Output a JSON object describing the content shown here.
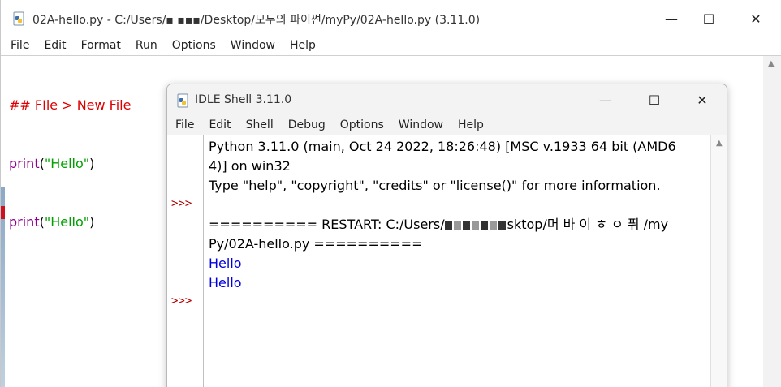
{
  "editor": {
    "title": "02A-hello.py - C:/Users/▪ ▪▪▪/Desktop/모두의 파이썬/myPy/02A-hello.py (3.11.0)",
    "menu": [
      "File",
      "Edit",
      "Format",
      "Run",
      "Options",
      "Window",
      "Help"
    ],
    "code": {
      "line1": "## FIle > New File",
      "line2_fn": "print",
      "line2_open": "(",
      "line2_str": "\"Hello\"",
      "line2_close": ")",
      "line3_fn": "print",
      "line3_open": "(",
      "line3_str": "\"Hello\"",
      "line3_close": ")"
    },
    "window_buttons": {
      "minimize": "—",
      "maximize": "☐",
      "close": "✕"
    }
  },
  "shell": {
    "title": "IDLE Shell 3.11.0",
    "menu": [
      "File",
      "Edit",
      "Shell",
      "Debug",
      "Options",
      "Window",
      "Help"
    ],
    "prompt": ">>>",
    "lines": {
      "banner1": "Python 3.11.0 (main, Oct 24 2022, 18:26:48) [MSC v.1933 64 bit (AMD6",
      "banner2": "4)] on win32",
      "banner3": "Type \"help\", \"copyright\", \"credits\" or \"license()\" for more information.",
      "restart_a": "========== RESTART: C:/Users/",
      "restart_b": "sktop/머 바 이 ㅎ ㅇ 퓌 /my",
      "restart_c": "Py/02A-hello.py ==========",
      "out1": "Hello",
      "out2": "Hello"
    },
    "window_buttons": {
      "minimize": "—",
      "maximize": "☐",
      "close": "✕"
    }
  },
  "colors": {
    "keyword": "#900090",
    "string": "#00a000",
    "comment": "#dd0000",
    "output": "#0000dd",
    "prompt": "#b00000"
  }
}
